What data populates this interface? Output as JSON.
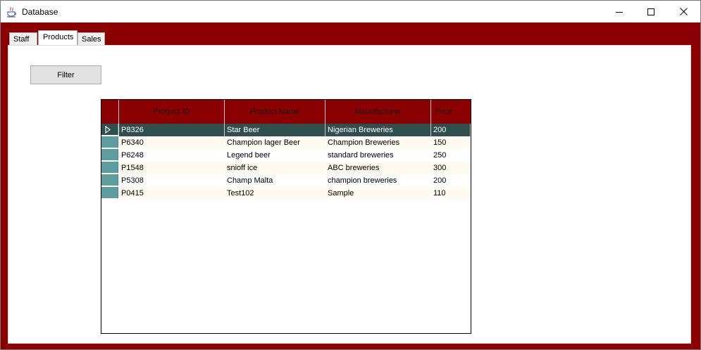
{
  "window": {
    "title": "Database",
    "accent_color": "#8b0000"
  },
  "tabs": [
    {
      "label": "Staff"
    },
    {
      "label": "Products"
    },
    {
      "label": "Sales"
    }
  ],
  "active_tab": "Products",
  "filter_button": {
    "label": "Filter"
  },
  "grid": {
    "columns": [
      "Product ID",
      "Product Name",
      "Manufacturer",
      "Price"
    ],
    "selected_row": 0,
    "rows": [
      {
        "id": "P8326",
        "name": "Star Beer",
        "manufacturer": "Nigerian Breweries",
        "price": "200"
      },
      {
        "id": "P6340",
        "name": "Champion lager Beer",
        "manufacturer": "Champion Breweries",
        "price": "150"
      },
      {
        "id": "P6248",
        "name": "Legend beer",
        "manufacturer": "standard breweries",
        "price": "250"
      },
      {
        "id": "P1548",
        "name": "snioff ice",
        "manufacturer": "ABC breweries",
        "price": "300"
      },
      {
        "id": "P5308",
        "name": "Champ Malta",
        "manufacturer": "champion breweries",
        "price": "200"
      },
      {
        "id": "P0415",
        "name": "Test102",
        "manufacturer": "Sample",
        "price": "110"
      }
    ],
    "header_color": "#8b0000",
    "selection_color": "#2f4f4f",
    "row_header_color": "#5f9ea0",
    "alt_row_color": "#fffaf0"
  },
  "icons": {
    "app": "java-cup-icon",
    "minimize": "minimize-icon",
    "maximize": "maximize-icon",
    "close": "close-icon",
    "row_indicator": "current-row-triangle-icon"
  }
}
